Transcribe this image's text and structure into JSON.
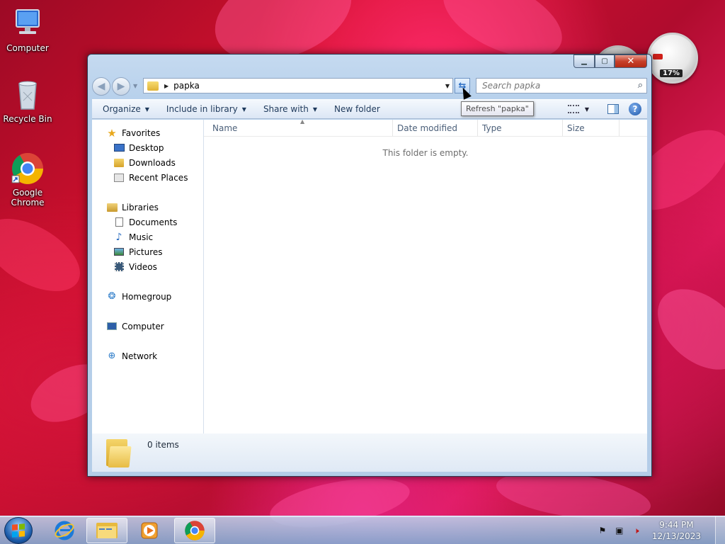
{
  "desktop": {
    "icons": [
      {
        "label": "Computer"
      },
      {
        "label": "Recycle Bin"
      },
      {
        "label": "Google Chrome"
      }
    ],
    "gadget": {
      "percent": "17%"
    }
  },
  "window": {
    "address": {
      "path": "papka"
    },
    "search": {
      "placeholder": "Search papka"
    },
    "toolbar": {
      "organize": "Organize",
      "include_in_library": "Include in library",
      "share_with": "Share with",
      "new_folder": "New folder"
    },
    "tooltip": "Refresh \"papka\"",
    "nav": {
      "favorites": "Favorites",
      "favorites_items": [
        "Desktop",
        "Downloads",
        "Recent Places"
      ],
      "libraries": "Libraries",
      "libraries_items": [
        "Documents",
        "Music",
        "Pictures",
        "Videos"
      ],
      "homegroup": "Homegroup",
      "computer": "Computer",
      "network": "Network"
    },
    "columns": [
      "Name",
      "Date modified",
      "Type",
      "Size"
    ],
    "empty_message": "This folder is empty.",
    "details": {
      "count": "0 items"
    }
  },
  "taskbar": {
    "time": "9:44 PM",
    "date": "12/13/2023"
  },
  "colors": {
    "accent": "#1e395b",
    "selection": "#3399ff"
  }
}
